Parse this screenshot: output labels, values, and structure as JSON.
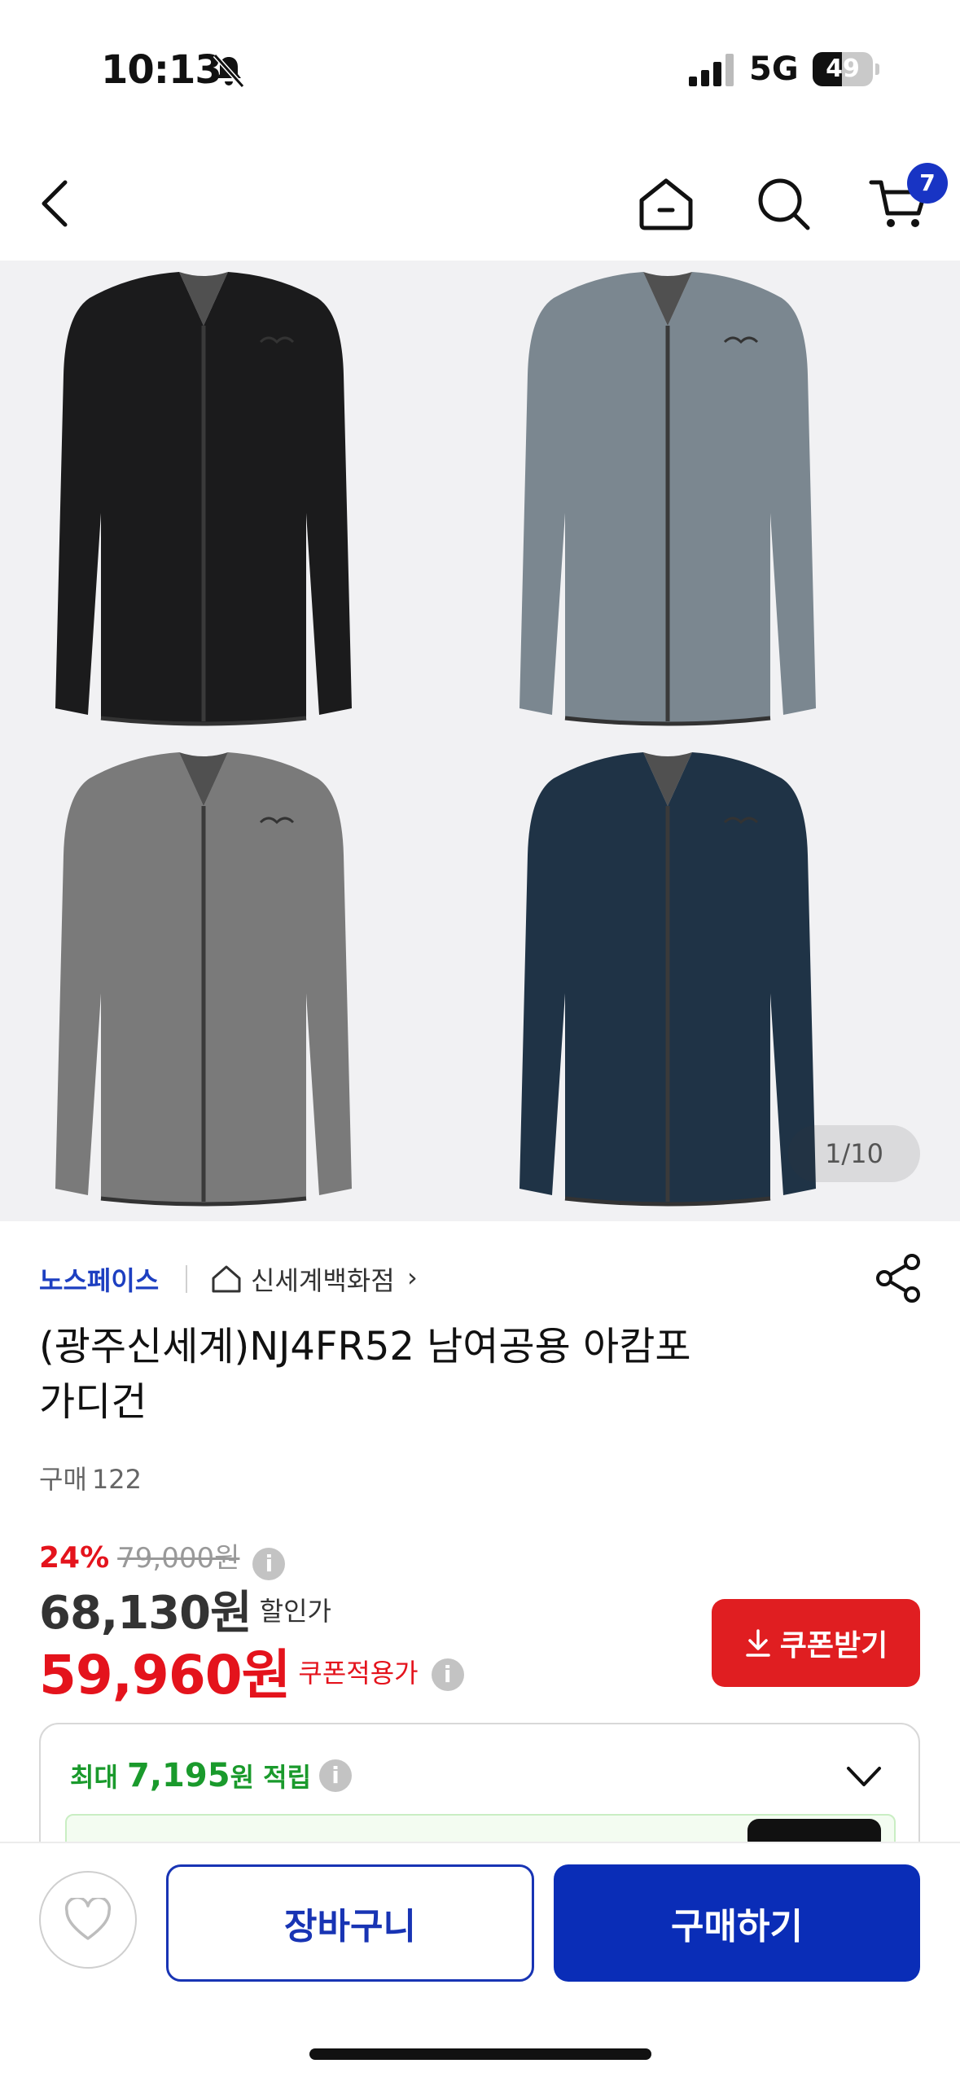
{
  "status_bar": {
    "time": "10:13",
    "network": "5G",
    "battery_level": "49",
    "battery_fraction": 0.49
  },
  "nav": {
    "cart_count": "7"
  },
  "gallery": {
    "counter": "1/10",
    "colors": {
      "black": "#1b1b1c",
      "light_gray": "#7b8790",
      "gray": "#7a7a7a",
      "navy": "#1f3346"
    }
  },
  "product": {
    "brand": "노스페이스",
    "store": "신세계백화점",
    "store_chevron": "›",
    "title_line1": "(광주신세계)NJ4FR52 남여공용 아캄포",
    "title_line2": "가디건",
    "purchase_label": "구매",
    "purchase_count": "122"
  },
  "pricing": {
    "discount": "24%",
    "original": "79,000원",
    "sale_price": "68,130원",
    "sale_label": "할인가",
    "coupon_price": "59,960원",
    "coupon_label": "쿠폰적용가",
    "coupon_button": "쿠폰받기",
    "info_glyph": "i"
  },
  "points": {
    "prefix": "최대",
    "amount": "7,195",
    "suffix": "원 적립"
  },
  "bottom": {
    "cart_button": "장바구니",
    "buy_button": "구매하기"
  },
  "theme": {
    "brand_blue": "#1834b4",
    "sale_red": "#e4131c",
    "points_green": "#1a9a2c"
  }
}
